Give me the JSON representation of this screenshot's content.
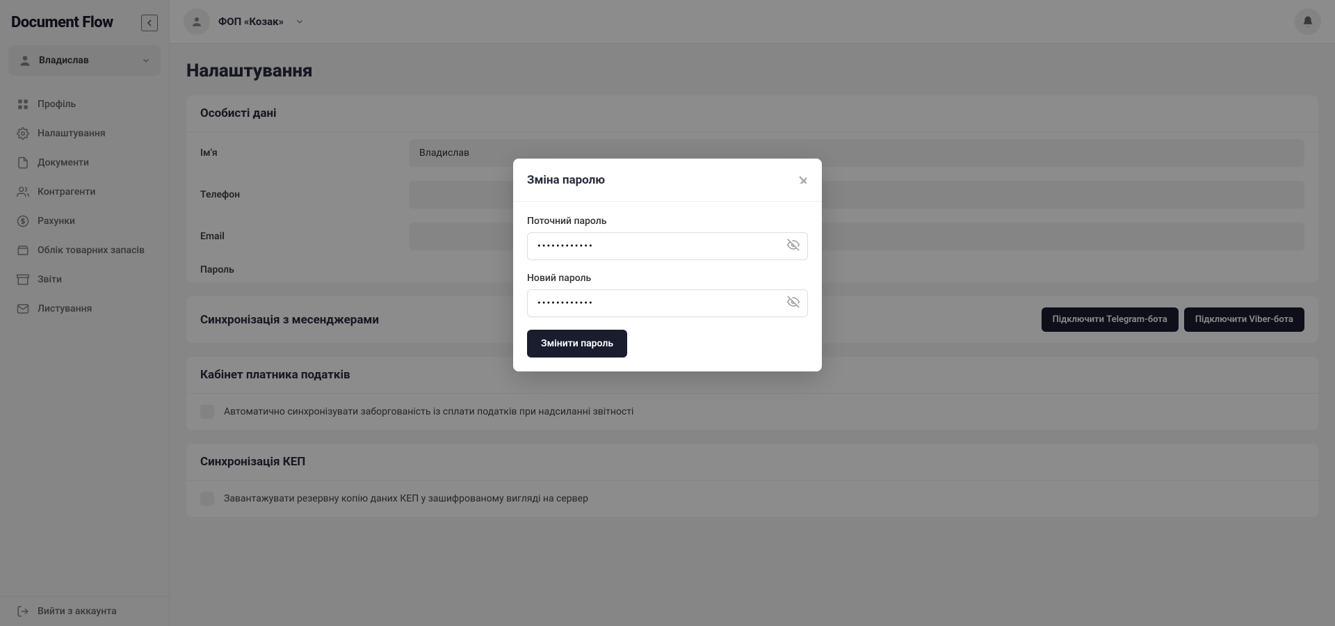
{
  "app_name": "Document Flow",
  "sidebar": {
    "user_name": "Владислав",
    "logout": "Вийти з аккаунта",
    "nav": [
      {
        "label": "Профіль"
      },
      {
        "label": "Налаштування"
      },
      {
        "label": "Документи"
      },
      {
        "label": "Контрагенти"
      },
      {
        "label": "Рахунки"
      },
      {
        "label": "Облік товарних запасів"
      },
      {
        "label": "Звіти"
      },
      {
        "label": "Листування"
      }
    ]
  },
  "header": {
    "company": "ФОП «Козак»"
  },
  "page": {
    "title": "Налаштування",
    "personal": {
      "heading": "Особисті дані",
      "name_label": "Ім'я",
      "name_value": "Владислав",
      "phone_label": "Телефон",
      "email_label": "Email",
      "password_label": "Пароль"
    },
    "messengers": {
      "heading": "Синхронізація з месенджерами",
      "telegram": "Підключити Telegram-бота",
      "viber": "Підключити Viber-бота"
    },
    "tax_cabinet": {
      "heading": "Кабінет платника податків",
      "sync_label": "Автоматично синхронізувати заборгованість із сплати податків при надсиланні звітності"
    },
    "kep": {
      "heading": "Синхронізація КЕП",
      "backup_label": "Завантажувати резервну копію даних КЕП у зашифрованому вигляді на сервер"
    }
  },
  "modal": {
    "title": "Зміна паролю",
    "current_label": "Поточний пароль",
    "new_label": "Новий пароль",
    "submit": "Змінити пароль",
    "current_value": "••••••••••••",
    "new_value": "••••••••••••"
  }
}
